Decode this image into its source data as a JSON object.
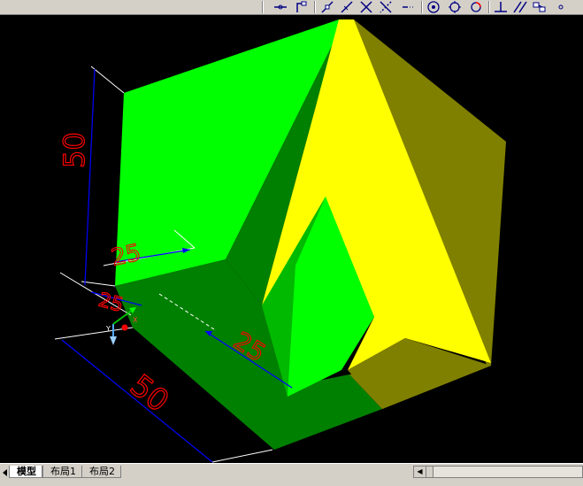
{
  "toolbar": {
    "icons": [
      "snap-node-icon",
      "snap-perpendicular-icon",
      "snap-tangent-icon",
      "snap-nearest-icon",
      "snap-intersection-icon",
      "snap-apparent-intersection-icon",
      "snap-extension-icon",
      "snap-center-icon",
      "snap-quadrant-icon",
      "snap-insert-icon",
      "snap-perpendicular2-icon",
      "snap-parallel-icon",
      "snap-block-icon",
      "snap-none-icon"
    ]
  },
  "dimensions": {
    "vertical": "50",
    "bottom": "50",
    "upper_small": "25",
    "lower_small": "25",
    "diagonal": "25"
  },
  "ucs": {
    "x_label": "X",
    "y_label": "Y"
  },
  "tabs": [
    {
      "label": "模型",
      "active": true
    },
    {
      "label": "布局1",
      "active": false
    },
    {
      "label": "布局2",
      "active": false
    }
  ],
  "colors": {
    "green_light": "#00ff00",
    "green_dark": "#008000",
    "yellow": "#ffff00",
    "olive": "#808000",
    "dimension_red": "#ff0000",
    "dimension_blue": "#0000ff",
    "background": "#000000"
  }
}
